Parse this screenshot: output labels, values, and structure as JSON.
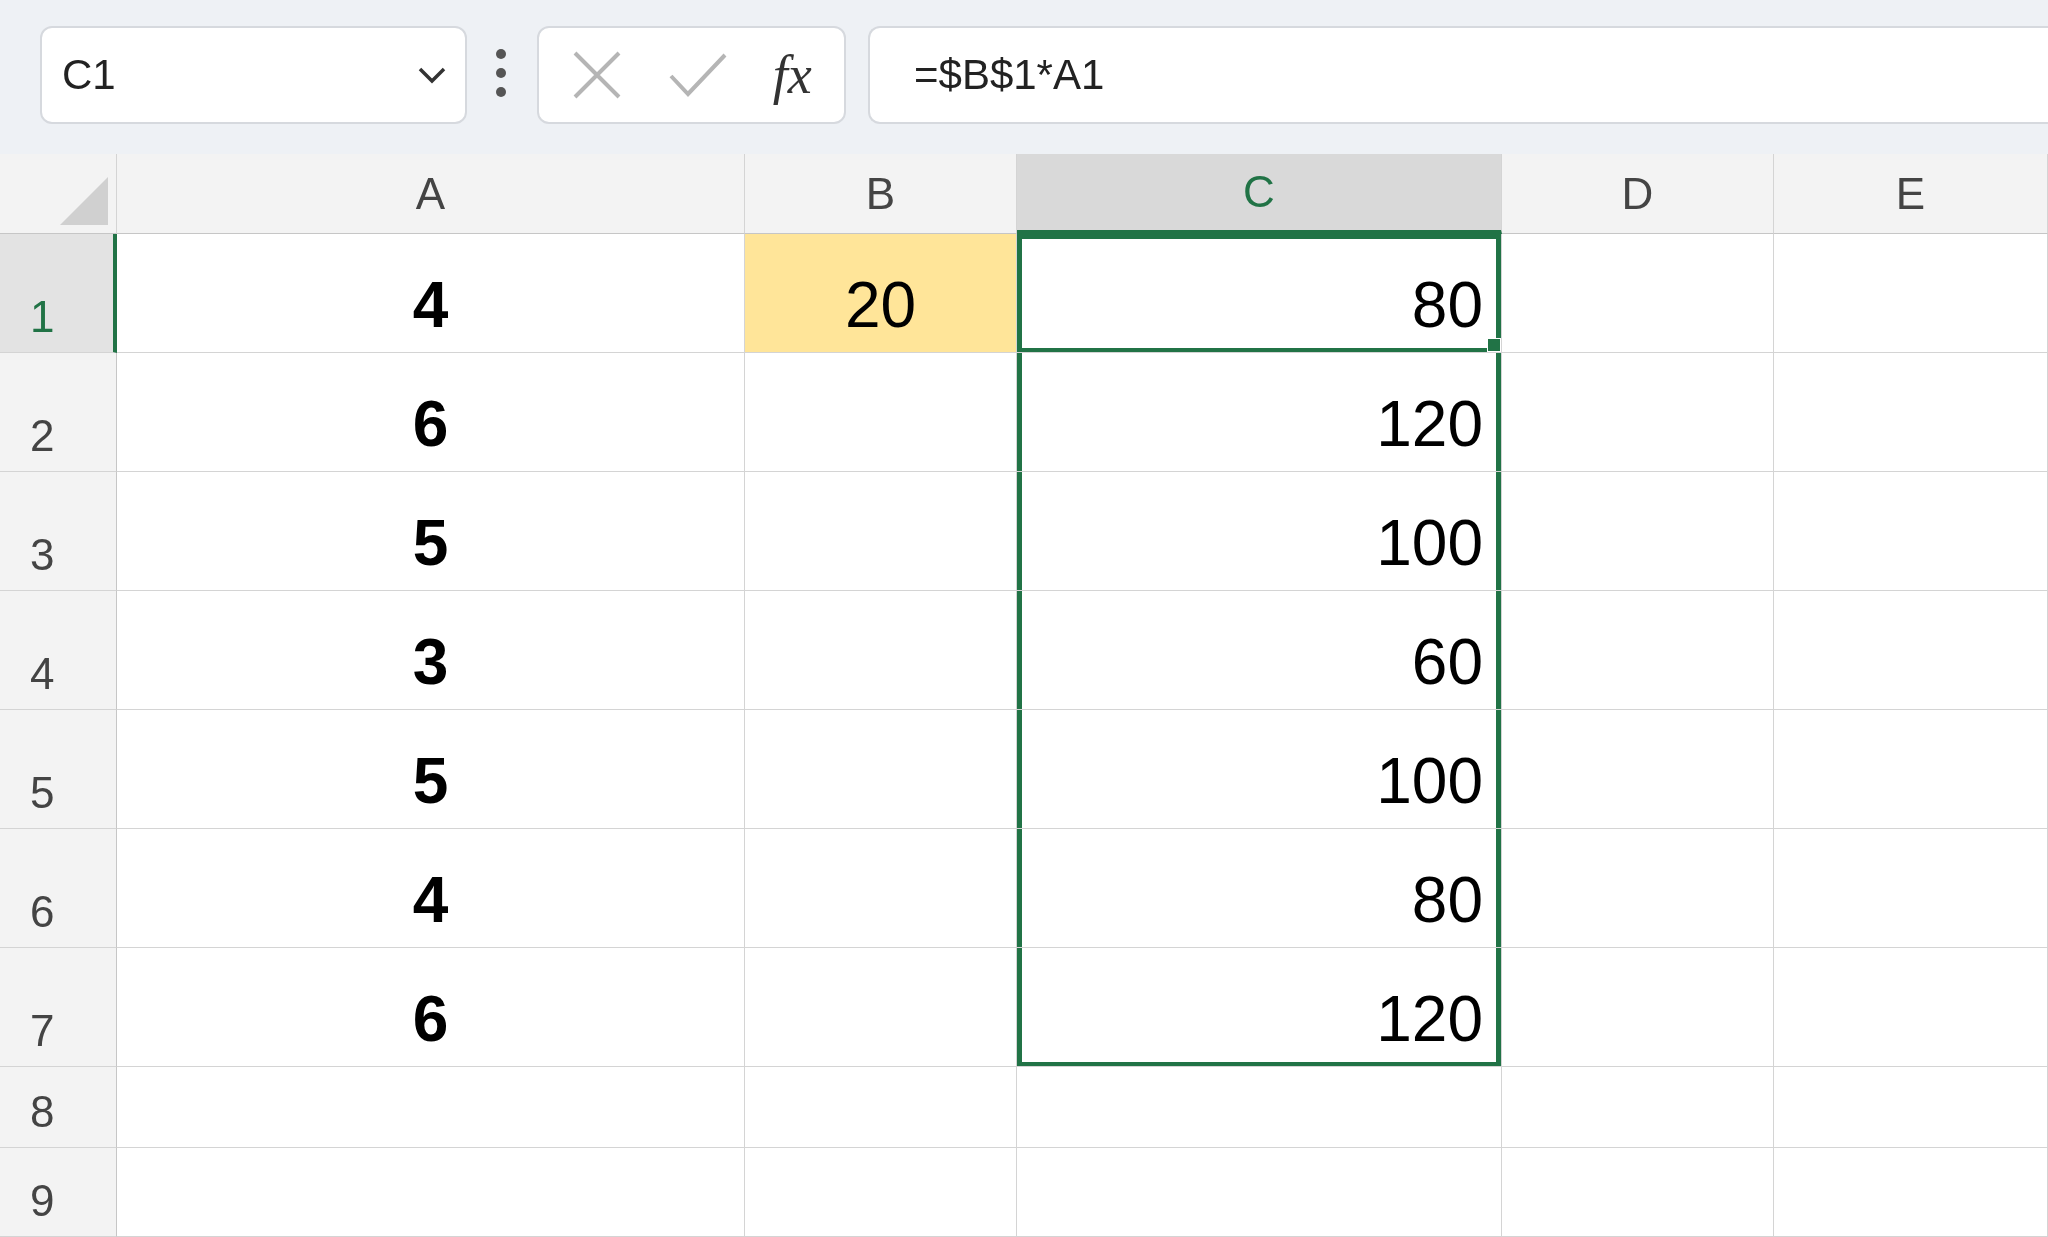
{
  "name_box": {
    "value": "C1"
  },
  "formula_buttons": {
    "function_label": "fx"
  },
  "formula_bar": {
    "value": "=$B$1*A1"
  },
  "columns": [
    {
      "label": "A",
      "selected": false
    },
    {
      "label": "B",
      "selected": false
    },
    {
      "label": "C",
      "selected": true
    },
    {
      "label": "D",
      "selected": false
    },
    {
      "label": "E",
      "selected": false
    }
  ],
  "rows": [
    {
      "label": "1",
      "selected": true,
      "cells": [
        {
          "value": "4",
          "bold": true,
          "highlighted": false,
          "selected": false
        },
        {
          "value": "20",
          "bold": false,
          "highlighted": true,
          "selected": false
        },
        {
          "value": "80",
          "bold": false,
          "highlighted": false,
          "selected": true,
          "active": true
        },
        {
          "highlighted": false,
          "selected": false
        },
        {
          "highlighted": false,
          "selected": false
        }
      ]
    },
    {
      "label": "2",
      "selected": false,
      "cells": [
        {
          "value": "6",
          "bold": true,
          "highlighted": false,
          "selected": false
        },
        {
          "highlighted": false,
          "selected": false
        },
        {
          "value": "120",
          "bold": false,
          "highlighted": false,
          "selected": true
        },
        {
          "highlighted": false,
          "selected": false
        },
        {
          "highlighted": false,
          "selected": false
        }
      ]
    },
    {
      "label": "3",
      "selected": false,
      "cells": [
        {
          "value": "5",
          "bold": true,
          "highlighted": false,
          "selected": false
        },
        {
          "highlighted": false,
          "selected": false
        },
        {
          "value": "100",
          "bold": false,
          "highlighted": false,
          "selected": true
        },
        {
          "highlighted": false,
          "selected": false
        },
        {
          "highlighted": false,
          "selected": false
        }
      ]
    },
    {
      "label": "4",
      "selected": false,
      "cells": [
        {
          "value": "3",
          "bold": true,
          "highlighted": false,
          "selected": false
        },
        {
          "highlighted": false,
          "selected": false
        },
        {
          "value": "60",
          "bold": false,
          "highlighted": false,
          "selected": true
        },
        {
          "highlighted": false,
          "selected": false
        },
        {
          "highlighted": false,
          "selected": false
        }
      ]
    },
    {
      "label": "5",
      "selected": false,
      "cells": [
        {
          "value": "5",
          "bold": true,
          "highlighted": false,
          "selected": false
        },
        {
          "highlighted": false,
          "selected": false
        },
        {
          "value": "100",
          "bold": false,
          "highlighted": false,
          "selected": true
        },
        {
          "highlighted": false,
          "selected": false
        },
        {
          "highlighted": false,
          "selected": false
        }
      ]
    },
    {
      "label": "6",
      "selected": false,
      "cells": [
        {
          "value": "4",
          "bold": true,
          "highlighted": false,
          "selected": false
        },
        {
          "highlighted": false,
          "selected": false
        },
        {
          "value": "80",
          "bold": false,
          "highlighted": false,
          "selected": true
        },
        {
          "highlighted": false,
          "selected": false
        },
        {
          "highlighted": false,
          "selected": false
        }
      ]
    },
    {
      "label": "7",
      "selected": false,
      "cells": [
        {
          "value": "6",
          "bold": true,
          "highlighted": false,
          "selected": false
        },
        {
          "highlighted": false,
          "selected": false
        },
        {
          "value": "120",
          "bold": false,
          "highlighted": false,
          "selected": true
        },
        {
          "highlighted": false,
          "selected": false
        },
        {
          "highlighted": false,
          "selected": false
        }
      ]
    },
    {
      "label": "8",
      "selected": false,
      "cells": [
        {
          "highlighted": false,
          "selected": false
        },
        {
          "highlighted": false,
          "selected": false
        },
        {
          "highlighted": false,
          "selected": false
        },
        {
          "highlighted": false,
          "selected": false
        },
        {
          "highlighted": false,
          "selected": false
        }
      ]
    },
    {
      "label": "9",
      "selected": false,
      "cells": [
        {
          "highlighted": false,
          "selected": false
        },
        {
          "highlighted": false,
          "selected": false
        },
        {
          "highlighted": false,
          "selected": false
        },
        {
          "highlighted": false,
          "selected": false
        },
        {
          "highlighted": false,
          "selected": false
        }
      ]
    }
  ]
}
